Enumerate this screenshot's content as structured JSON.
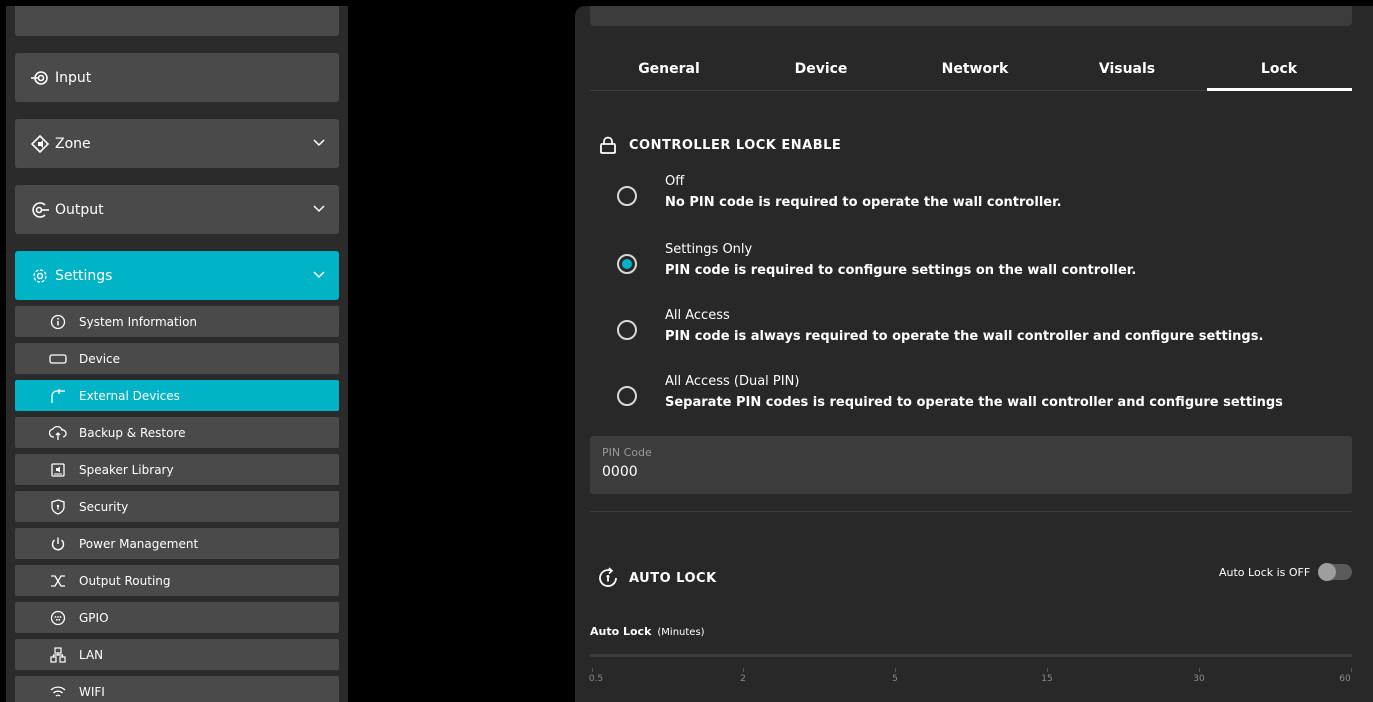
{
  "sidebar": {
    "nav": [
      {
        "label": "Input",
        "icon": "input-icon",
        "chevron": ""
      },
      {
        "label": "Zone",
        "icon": "zone-icon",
        "chevron": "⌵"
      },
      {
        "label": "Output",
        "icon": "output-icon",
        "chevron": "⌵"
      },
      {
        "label": "Settings",
        "icon": "gear-icon",
        "chevron": "⌵"
      }
    ],
    "sub_items": [
      {
        "label": "System Information",
        "icon": "info-icon"
      },
      {
        "label": "Device",
        "icon": "device-icon"
      },
      {
        "label": "External Devices",
        "icon": "external-devices-icon"
      },
      {
        "label": "Backup & Restore",
        "icon": "backup-icon"
      },
      {
        "label": "Speaker Library",
        "icon": "speaker-library-icon"
      },
      {
        "label": "Security",
        "icon": "shield-icon"
      },
      {
        "label": "Power Management",
        "icon": "power-icon"
      },
      {
        "label": "Output Routing",
        "icon": "routing-icon"
      },
      {
        "label": "GPIO",
        "icon": "gpio-icon"
      },
      {
        "label": "LAN",
        "icon": "lan-icon"
      },
      {
        "label": "WIFI",
        "icon": "wifi-icon"
      }
    ],
    "active_sub_item": "External Devices"
  },
  "tabs": [
    "General",
    "Device",
    "Network",
    "Visuals",
    "Lock"
  ],
  "active_tab": "Lock",
  "controller_lock": {
    "title": "CONTROLLER LOCK ENABLE",
    "options": [
      {
        "title": "Off",
        "desc": "No PIN code is required to operate the wall controller.",
        "checked": false
      },
      {
        "title": "Settings Only",
        "desc": "PIN code is required to configure settings on the wall controller.",
        "checked": true
      },
      {
        "title": "All Access",
        "desc": "PIN code is always required to operate the wall controller and configure settings.",
        "checked": false
      },
      {
        "title": "All Access (Dual PIN)",
        "desc": "Separate PIN codes is required to operate the wall controller and configure settings",
        "checked": false
      }
    ]
  },
  "pin": {
    "label": "PIN Code",
    "value": "0000"
  },
  "auto_lock": {
    "title": "AUTO LOCK",
    "toggle_label": "Auto Lock is OFF",
    "enabled": false,
    "slider_label": "Auto Lock",
    "slider_unit": "(Minutes)",
    "ticks": [
      "0.5",
      "2",
      "5",
      "15",
      "30",
      "60"
    ]
  },
  "colors": {
    "accent": "#00b3c7",
    "panel": "#282828",
    "item": "#4a4a4a"
  }
}
